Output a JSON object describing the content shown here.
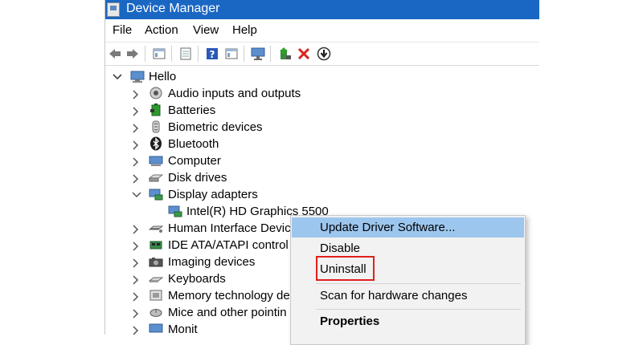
{
  "window": {
    "title": "Device Manager"
  },
  "menu": [
    "File",
    "Action",
    "View",
    "Help"
  ],
  "toolbar": [
    {
      "icon": "back-arrow-icon"
    },
    {
      "icon": "forward-arrow-icon"
    },
    {
      "icon": "properties-sheet-icon"
    },
    {
      "icon": "document-icon"
    },
    {
      "icon": "help-icon"
    },
    {
      "icon": "properties-sheet-icon"
    },
    {
      "icon": "monitor-icon"
    },
    {
      "icon": "update-driver-icon"
    },
    {
      "icon": "uninstall-x-icon"
    },
    {
      "icon": "disable-device-icon"
    }
  ],
  "tree": {
    "root": "Hello",
    "items": [
      {
        "label": "Audio inputs and outputs",
        "icon": "speaker-icon",
        "expanded": false
      },
      {
        "label": "Batteries",
        "icon": "battery-icon",
        "expanded": false
      },
      {
        "label": "Biometric devices",
        "icon": "fingerprint-icon",
        "expanded": false
      },
      {
        "label": "Bluetooth",
        "icon": "bluetooth-icon",
        "expanded": false
      },
      {
        "label": "Computer",
        "icon": "computer-icon",
        "expanded": false
      },
      {
        "label": "Disk drives",
        "icon": "disk-drive-icon",
        "expanded": false
      },
      {
        "label": "Display adapters",
        "icon": "display-adapter-icon",
        "expanded": true
      },
      {
        "label": "Intel(R) HD Graphics 5500",
        "icon": "display-adapter-icon",
        "child": true
      },
      {
        "label": "Human Interface Devic",
        "icon": "hid-icon",
        "expanded": false
      },
      {
        "label": "IDE ATA/ATAPI control",
        "icon": "ide-controller-icon",
        "expanded": false
      },
      {
        "label": "Imaging devices",
        "icon": "camera-icon",
        "expanded": false
      },
      {
        "label": "Keyboards",
        "icon": "keyboard-icon",
        "expanded": false
      },
      {
        "label": "Memory technology de",
        "icon": "memory-icon",
        "expanded": false
      },
      {
        "label": "Mice and other pointin",
        "icon": "mouse-icon",
        "expanded": false
      },
      {
        "label": "Monit",
        "icon": "monitor-icon",
        "expanded": false
      }
    ]
  },
  "context_menu": {
    "items": [
      {
        "label": "Update Driver Software...",
        "highlighted": true
      },
      {
        "label": "Disable"
      },
      {
        "label": "Uninstall",
        "annotated": true
      },
      {
        "label": "Scan for hardware changes"
      },
      {
        "label": "Properties",
        "bold": true
      }
    ]
  },
  "colors": {
    "titlebar": "#1a67c3",
    "highlight": "#9dc6ee",
    "annotation": "#e0201a"
  }
}
